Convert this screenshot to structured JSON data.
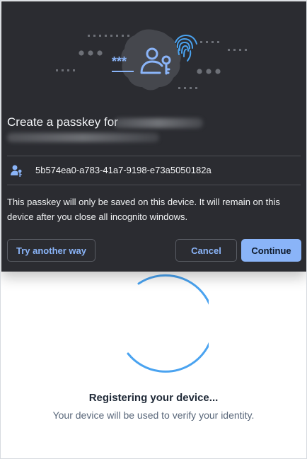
{
  "passkey_dialog": {
    "title": "Create a passkey for",
    "account_id": "5b574ea0-a783-41a7-9198-e73a5050182a",
    "notice": "This passkey will only be saved on this device. It will remain on this device after you close all incognito windows.",
    "buttons": {
      "try_another_way": "Try another way",
      "cancel": "Cancel",
      "continue": "Continue"
    },
    "hero_text": "***",
    "icons": {
      "hero": [
        "passkey-illustration-icon",
        "person-key-icon",
        "fingerprint-icon"
      ],
      "account": "person-key-icon"
    }
  },
  "loader": {
    "title": "Registering your device...",
    "subtitle": "Your device will be used to verify your identity."
  },
  "colors": {
    "dialog_bg": "#2b2c31",
    "accent_blue": "#8ab4f8",
    "spinner_blue": "#4aa3f0",
    "loader_text": "#1f2937",
    "loader_subtext": "#59677a"
  }
}
